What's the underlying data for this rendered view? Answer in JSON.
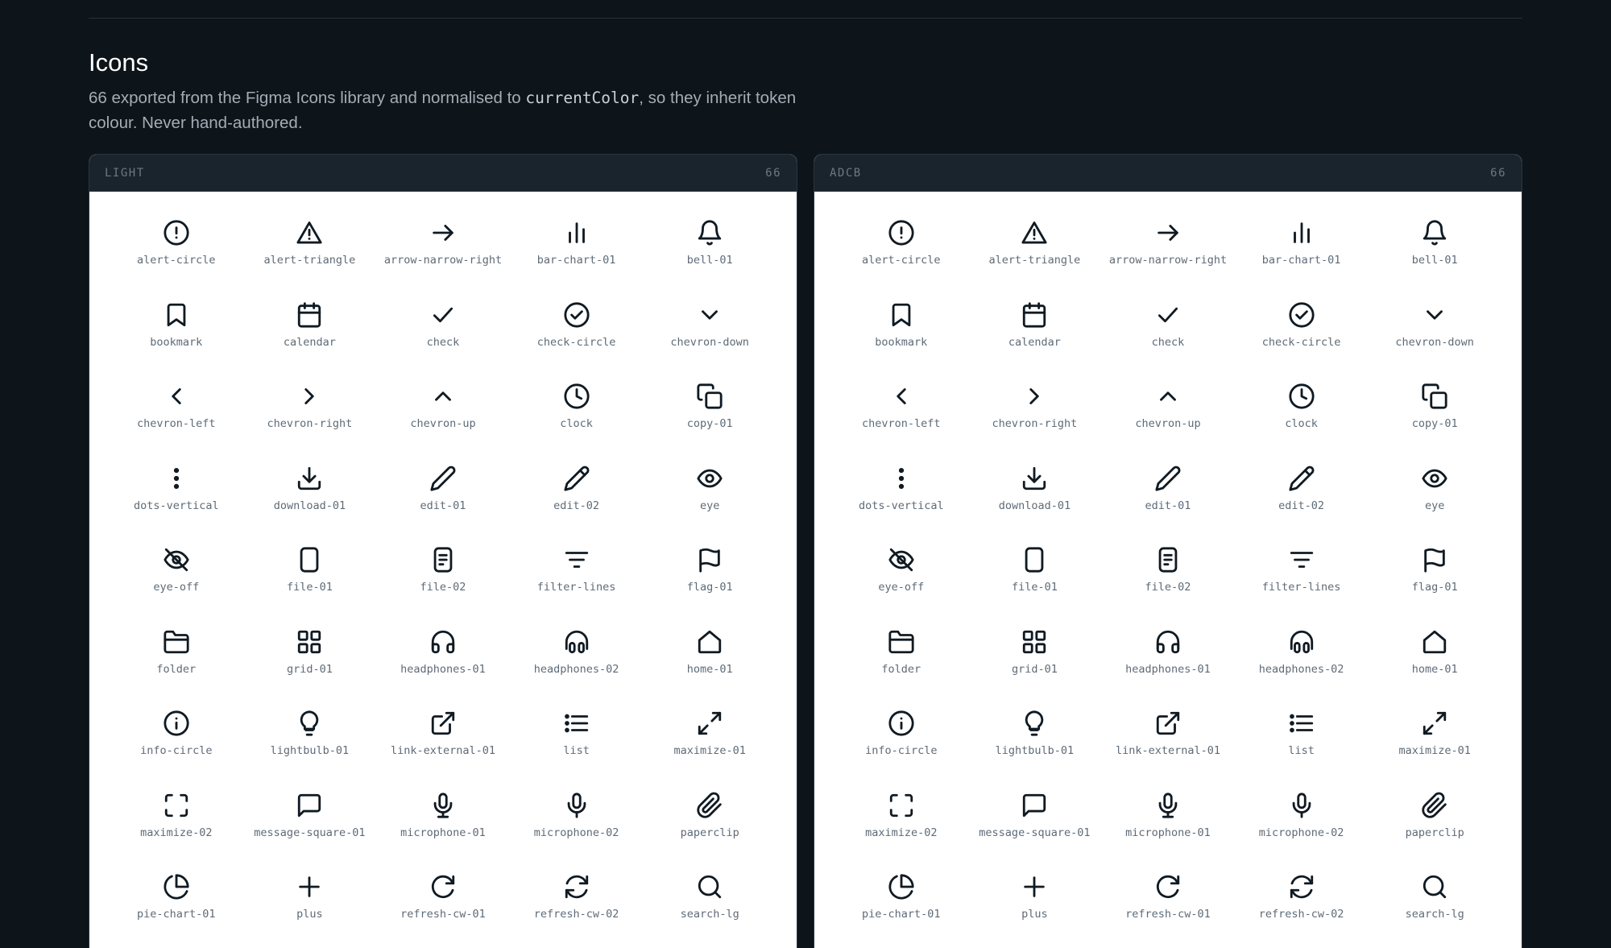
{
  "section": {
    "title": "Icons",
    "desc_before": "66 exported from the Figma Icons library and normalised to ",
    "desc_code": "currentColor",
    "desc_after": ", so they inherit token colour. Never hand-authored."
  },
  "panels": [
    {
      "label": "LIGHT",
      "count": "66",
      "icon_color": "#101a22"
    },
    {
      "label": "ADCB",
      "count": "66",
      "icon_color": "#101a22"
    }
  ],
  "icons": [
    "alert-circle",
    "alert-triangle",
    "arrow-narrow-right",
    "bar-chart-01",
    "bell-01",
    "bookmark",
    "calendar",
    "check",
    "check-circle",
    "chevron-down",
    "chevron-left",
    "chevron-right",
    "chevron-up",
    "clock",
    "copy-01",
    "dots-vertical",
    "download-01",
    "edit-01",
    "edit-02",
    "eye",
    "eye-off",
    "file-01",
    "file-02",
    "filter-lines",
    "flag-01",
    "folder",
    "grid-01",
    "headphones-01",
    "headphones-02",
    "home-01",
    "info-circle",
    "lightbulb-01",
    "link-external-01",
    "list",
    "maximize-01",
    "maximize-02",
    "message-square-01",
    "microphone-01",
    "microphone-02",
    "paperclip",
    "pie-chart-01",
    "plus",
    "refresh-cw-01",
    "refresh-cw-02",
    "search-lg"
  ]
}
